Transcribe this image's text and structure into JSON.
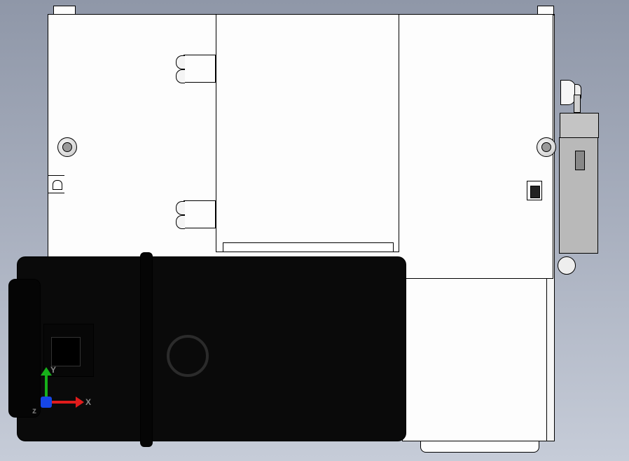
{
  "triad": {
    "x_label": "X",
    "y_label": "Y",
    "z_label": "z",
    "x_color": "#e01b1b",
    "y_color": "#17b01a",
    "z_color": "#1646e6"
  }
}
